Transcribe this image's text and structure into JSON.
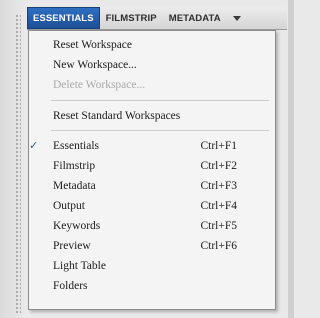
{
  "tabs": [
    {
      "label": "ESSENTIALS",
      "active": true
    },
    {
      "label": "FILMSTRIP",
      "active": false
    },
    {
      "label": "METADATA",
      "active": false
    }
  ],
  "menu": {
    "workspace_items": [
      {
        "label": "Reset Workspace",
        "enabled": true
      },
      {
        "label": "New Workspace...",
        "enabled": true
      },
      {
        "label": "Delete Workspace...",
        "enabled": false
      }
    ],
    "reset_standard_label": "Reset Standard Workspaces",
    "workspaces": [
      {
        "label": "Essentials",
        "shortcut": "Ctrl+F1",
        "checked": true
      },
      {
        "label": "Filmstrip",
        "shortcut": "Ctrl+F2",
        "checked": false
      },
      {
        "label": "Metadata",
        "shortcut": "Ctrl+F3",
        "checked": false
      },
      {
        "label": "Output",
        "shortcut": "Ctrl+F4",
        "checked": false
      },
      {
        "label": "Keywords",
        "shortcut": "Ctrl+F5",
        "checked": false
      },
      {
        "label": "Preview",
        "shortcut": "Ctrl+F6",
        "checked": false
      },
      {
        "label": "Light Table",
        "shortcut": "",
        "checked": false
      },
      {
        "label": "Folders",
        "shortcut": "",
        "checked": false
      }
    ],
    "check_icon": "checkmark-icon",
    "check_glyph": "✓"
  },
  "colors": {
    "active_tab": "#2565b5",
    "check": "#2b5ea8",
    "disabled_text": "#a9a9a9"
  }
}
